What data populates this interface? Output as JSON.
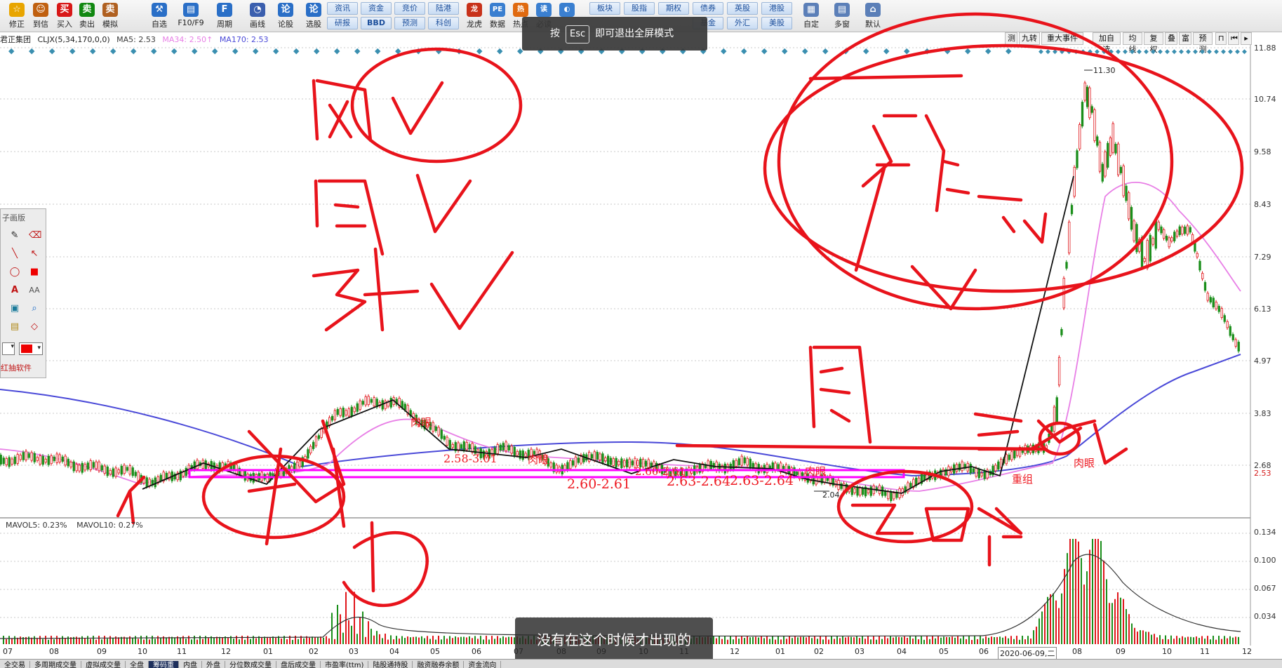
{
  "toolbar": {
    "buttons": [
      {
        "label": "修正",
        "icon": "sun-icon",
        "color": "#e8a500"
      },
      {
        "label": "到信",
        "icon": "clock-icon",
        "color": "#c06010"
      },
      {
        "label": "买入",
        "icon": "buy-icon",
        "color": "#d81818",
        "glyph": "买"
      },
      {
        "label": "卖出",
        "icon": "sell-icon",
        "color": "#118811",
        "glyph": "卖"
      },
      {
        "label": "模拟",
        "icon": "gavel-icon",
        "color": "#b06020"
      },
      {
        "label": "自选",
        "icon": "folder-icon",
        "color": "#2a6fc7"
      },
      {
        "label": "F10/F9",
        "icon": "f10-icon",
        "color": "#2a6fc7"
      },
      {
        "label": "周期",
        "icon": "cycle-icon",
        "color": "#2a6fc7"
      },
      {
        "label": "画线",
        "icon": "pen-icon",
        "color": "#3b5fae"
      },
      {
        "label": "论股",
        "icon": "talk-icon",
        "color": "#2a6fc7",
        "glyph": "论"
      },
      {
        "label": "选股",
        "icon": "select-icon",
        "color": "#2a6fc7"
      }
    ],
    "tabs_top": [
      "资讯",
      "资金",
      "竞价",
      "陆港"
    ],
    "tabs_bottom": [
      "研报",
      "BBD",
      "预测",
      "科创"
    ],
    "mid_buttons": [
      {
        "label": "龙虎",
        "icon": "dragon-icon"
      },
      {
        "label": "数据",
        "icon": "pe-icon"
      },
      {
        "label": "热点",
        "icon": "hot-icon"
      },
      {
        "label": "必读",
        "icon": "doc-icon"
      },
      {
        "label": "",
        "icon": "globe-icon"
      }
    ],
    "tabs2_top": [
      "板块",
      "股指",
      "期权",
      "债券",
      "英股",
      "港股"
    ],
    "tabs2_bottom": [
      "基金",
      "外汇",
      "美股"
    ],
    "right_buttons": [
      {
        "label": "自定",
        "icon": "custom-icon"
      },
      {
        "label": "多窗",
        "icon": "window-icon"
      },
      {
        "label": "默认",
        "icon": "home-icon"
      }
    ]
  },
  "esc_banner": {
    "prefix": "按",
    "key": "Esc",
    "suffix": "即可退出全屏模式"
  },
  "legend": {
    "stock_name": "君正集团",
    "indicator": "CLJX(5,34,170,0,0)",
    "ma5": "MA5: 2.53",
    "ma34": "MA34: 2.50↑",
    "ma170": "MA170: 2.53"
  },
  "right_tabs": [
    "测",
    "九转",
    "重大事件",
    "加自选",
    "均线",
    "复权",
    "叠",
    "富",
    "预测"
  ],
  "price_axis": [
    "11.88",
    "10.74",
    "9.58",
    "8.43",
    "7.29",
    "6.13",
    "4.97",
    "3.83",
    "2.68",
    "2.53"
  ],
  "volume_axis": [
    "0.134",
    "0.100",
    "0.067",
    "0.034"
  ],
  "volume_legend": {
    "mavol5": "MAVOL5: 0.23%",
    "mavol10": "MAVOL10: 0.27%"
  },
  "date_axis": [
    "07",
    "08",
    "09",
    "10",
    "11",
    "12",
    "01",
    "02",
    "03",
    "04",
    "05",
    "06",
    "07",
    "08",
    "09",
    "10",
    "11",
    "12",
    "01",
    "02",
    "03",
    "04",
    "05",
    "06",
    "2020-06-09,二",
    "08",
    "09",
    "10",
    "11",
    "12"
  ],
  "chart_annotations": {
    "max_price": "11.30",
    "min_price": "2.04",
    "range1": "2.60-2.61",
    "range2": "2.63-2.64",
    "range3": "2.63-2.64",
    "range4": "2.60-2.61",
    "range5": "2.58-3.01",
    "tag1": "肉眼",
    "tag2": "肉眼",
    "tag3": "肉眼",
    "tag4": "重组",
    "tag5": "肉眼"
  },
  "draw_panel": {
    "title": "子画版",
    "footer": "红抽软件"
  },
  "subtitle": "没有在这个时候才出现的",
  "bottom_tabs": [
    "全交易",
    "多周期成交量",
    "虚拟成交量",
    "全盘",
    "筹码重",
    "内盘",
    "外盘",
    "分位数成交量",
    "盘后成交量",
    "市盈率(ttm)",
    "陆股通持股",
    "融资融券余额",
    "资金流向"
  ],
  "colors": {
    "candle_up": "#e0161b",
    "candle_down": "#1a8e1a",
    "ma_pink": "#e87fe6",
    "ma_blue": "#4a49d8",
    "handwriting": "#e8131b"
  }
}
